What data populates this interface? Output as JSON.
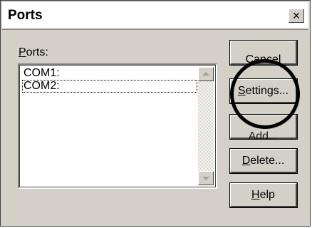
{
  "window": {
    "title": "Ports",
    "close_label": "×"
  },
  "ports": {
    "label_mnemonic": "P",
    "label_rest": "orts:",
    "items": [
      "COM1:",
      "COM2:"
    ]
  },
  "buttons": {
    "cancel": "Cancel",
    "settings_mnemonic": "S",
    "settings_rest": "ettings...",
    "add": "Add...",
    "delete_mnemonic": "D",
    "delete_rest": "elete...",
    "help_mnemonic": "H",
    "help_rest": "elp"
  }
}
